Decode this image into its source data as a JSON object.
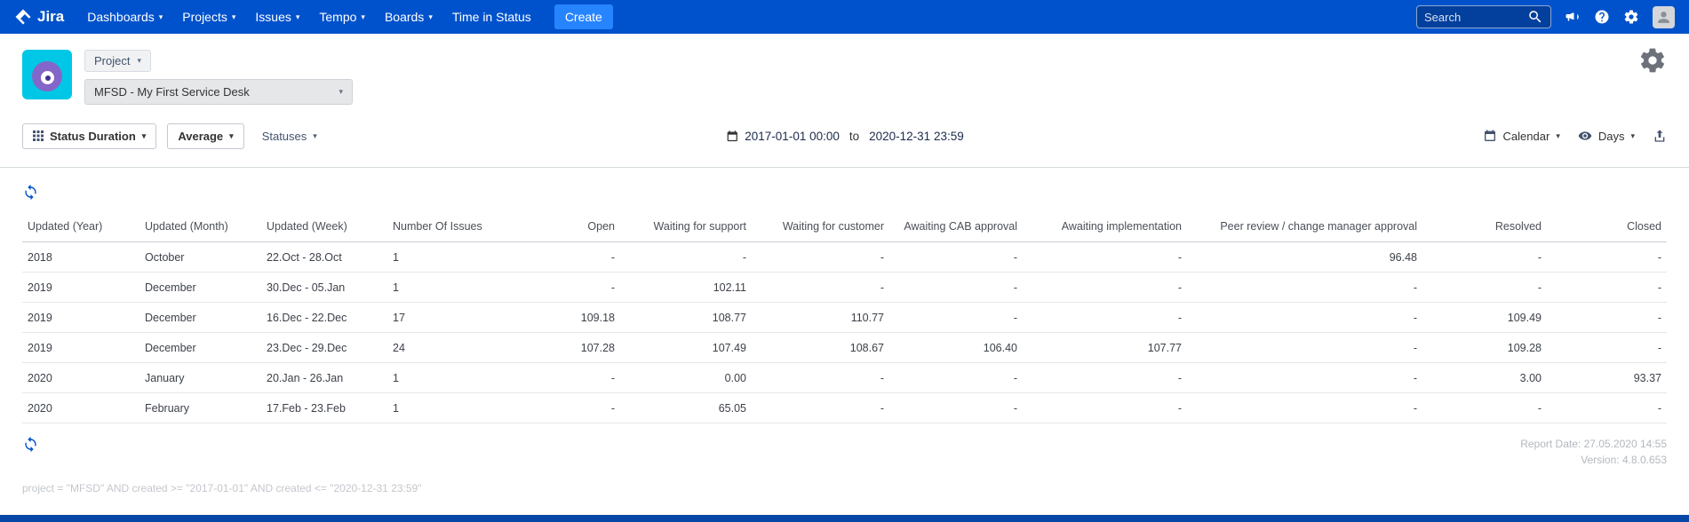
{
  "icons": {
    "chevron_down": "▾"
  },
  "nav": {
    "brand": "Jira",
    "items": [
      "Dashboards",
      "Projects",
      "Issues",
      "Tempo",
      "Boards",
      "Time in Status"
    ],
    "create_label": "Create",
    "search_placeholder": "Search"
  },
  "project": {
    "selector_label": "Project",
    "selected": "MFSD - My First Service Desk"
  },
  "toolbar": {
    "report_type": "Status Duration",
    "aggregation": "Average",
    "statuses_label": "Statuses",
    "date_from": "2017-01-01 00:00",
    "date_to_word": "to",
    "date_to": "2020-12-31 23:59",
    "calendar_label": "Calendar",
    "unit_label": "Days"
  },
  "table": {
    "columns": [
      "Updated (Year)",
      "Updated (Month)",
      "Updated (Week)",
      "Number Of Issues",
      "Open",
      "Waiting for support",
      "Waiting for customer",
      "Awaiting CAB approval",
      "Awaiting implementation",
      "Peer review / change manager approval",
      "Resolved",
      "Closed"
    ],
    "rows": [
      [
        "2018",
        "October",
        "22.Oct - 28.Oct",
        "1",
        "-",
        "-",
        "-",
        "-",
        "-",
        "96.48",
        "-",
        "-"
      ],
      [
        "2019",
        "December",
        "30.Dec - 05.Jan",
        "1",
        "-",
        "102.11",
        "-",
        "-",
        "-",
        "-",
        "-",
        "-"
      ],
      [
        "2019",
        "December",
        "16.Dec - 22.Dec",
        "17",
        "109.18",
        "108.77",
        "110.77",
        "-",
        "-",
        "-",
        "109.49",
        "-"
      ],
      [
        "2019",
        "December",
        "23.Dec - 29.Dec",
        "24",
        "107.28",
        "107.49",
        "108.67",
        "106.40",
        "107.77",
        "-",
        "109.28",
        "-"
      ],
      [
        "2020",
        "January",
        "20.Jan - 26.Jan",
        "1",
        "-",
        "0.00",
        "-",
        "-",
        "-",
        "-",
        "3.00",
        "93.37"
      ],
      [
        "2020",
        "February",
        "17.Feb - 23.Feb",
        "1",
        "-",
        "65.05",
        "-",
        "-",
        "-",
        "-",
        "-",
        "-"
      ]
    ]
  },
  "footer": {
    "report_date": "Report Date: 27.05.2020 14:55",
    "version": "Version: 4.8.0.653",
    "query": "project = \"MFSD\" AND created >= \"2017-01-01\" AND created <= \"2020-12-31 23:59\""
  }
}
